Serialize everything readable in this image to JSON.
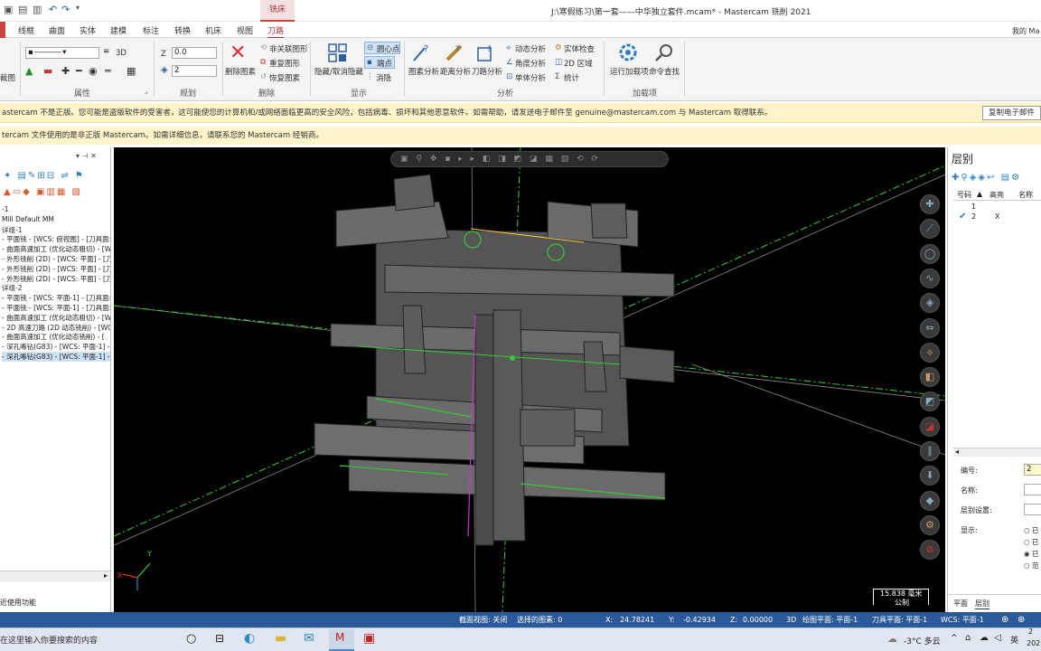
{
  "window": {
    "title": "J:\\寒假练习\\第一套——中华独立套件.mcam* - Mastercam 铣削 2021",
    "context_tab": "铣床",
    "user": "我的 Ma"
  },
  "menu": {
    "tabs": [
      "线框",
      "曲面",
      "实体",
      "建模",
      "标注",
      "转换",
      "机床",
      "视图",
      "刀路"
    ]
  },
  "ribbon": {
    "attributes": {
      "group": "属性",
      "line_width_label": "3D"
    },
    "plan": {
      "group": "规划",
      "z_label": "Z",
      "z_value": "0.0",
      "level_value": "2"
    },
    "delete": {
      "group": "删除",
      "delete_entity": "删除图素",
      "non_assoc": "非关联图形",
      "dup": "重复图形",
      "restore": "恢复图素"
    },
    "display": {
      "group": "显示",
      "hide": "隐藏/取消隐藏",
      "circle_center": "圆心点",
      "endpoint": "端点",
      "blank": "消隐"
    },
    "analyze": {
      "group": "分析",
      "entity": "图素分析",
      "distance": "距离分析",
      "toolpath": "刀路分析",
      "dynamic": "动态分析",
      "angle": "角度分析",
      "single": "单体分析",
      "solid_check": "实体检查",
      "area_2d": "2D 区域",
      "stats": "统计"
    },
    "addins": {
      "group": "加载项",
      "run": "运行加载项",
      "cmd": "命令查找"
    },
    "left_label": "截图"
  },
  "warnings": {
    "line1": "astercam 不是正版。您可能是盗版软件的受害者，这可能使您的计算机和/或网络面临更高的安全风险，包括病毒、损坏和其他恶意软件。如需帮助，请发送电子邮件至 genuine@mastercam.com 与 Mastercam 取得联系。",
    "copy_button": "复制电子邮件",
    "line2": "tercam 文件使用的是非正版 Mastercam。如需详细信息，请联系您的 Mastercam 经销商。"
  },
  "toolpath_tree": {
    "lines": [
      "-1",
      "Mill Default MM",
      "详组-1",
      "- 平面铣 - [WCS: 俯视图] - [刀具面:",
      "- 曲面高速加工 (优化动态粗切) - [W",
      "- 外形铣削 (2D) - [WCS: 平面] - [刀J",
      "- 外形铣削 (2D) - [WCS: 平面] - [刀J",
      "- 外形铣削 (2D) - [WCS: 平面] - [刀J",
      "详组-2",
      "- 平面铣 - [WCS: 平面-1] - [刀具面:",
      "- 平面铣 - [WCS: 平面-1] - [刀具面:",
      "- 曲面高速加工 (优化动态粗切) - [W",
      "- 2D 高速刀路 (2D 动态铣削) - [WCS",
      "- 曲面高速加工 (优化动态铣削) - [",
      "- 深孔啄钻(G83) - [WCS: 平面-1] -",
      "- 深孔啄钻(G83) - [WCS: 平面-1] -"
    ],
    "footer": "近使用功能"
  },
  "levels": {
    "title": "层别",
    "col_num": "号码",
    "col_high": "高亮",
    "col_name": "名称",
    "rows": [
      {
        "num": "1",
        "high": ""
      },
      {
        "num": "2",
        "high": "X"
      }
    ],
    "number_label": "编号:",
    "number_value": "2",
    "name_label": "名称:",
    "set_label": "层别设置:",
    "display_label": "显示:",
    "radios": [
      "已",
      "已",
      "已",
      "范"
    ],
    "tabs": [
      "平面",
      "层别"
    ]
  },
  "viewport": {
    "scale_value": "15.838 毫米",
    "scale_unit": "公制",
    "axis_y": "Y",
    "axis_x": "X"
  },
  "status": {
    "section": "截面视图: 关闭",
    "selected": "选择的图素: 0",
    "x_label": "X:",
    "x": "24.78241",
    "y_label": "Y:",
    "y": "-0.42934",
    "z_label": "Z:",
    "z": "0.00000",
    "mode": "3D",
    "gplane": "绘图平面: 平面-1",
    "tplane": "刀具平面: 平面-1",
    "wcs": "WCS: 平面-1"
  },
  "taskbar": {
    "search": "在这里输入你要搜索的内容",
    "weather": "-3°C 多云",
    "lang": "英",
    "year": "202",
    "num2": "2"
  }
}
